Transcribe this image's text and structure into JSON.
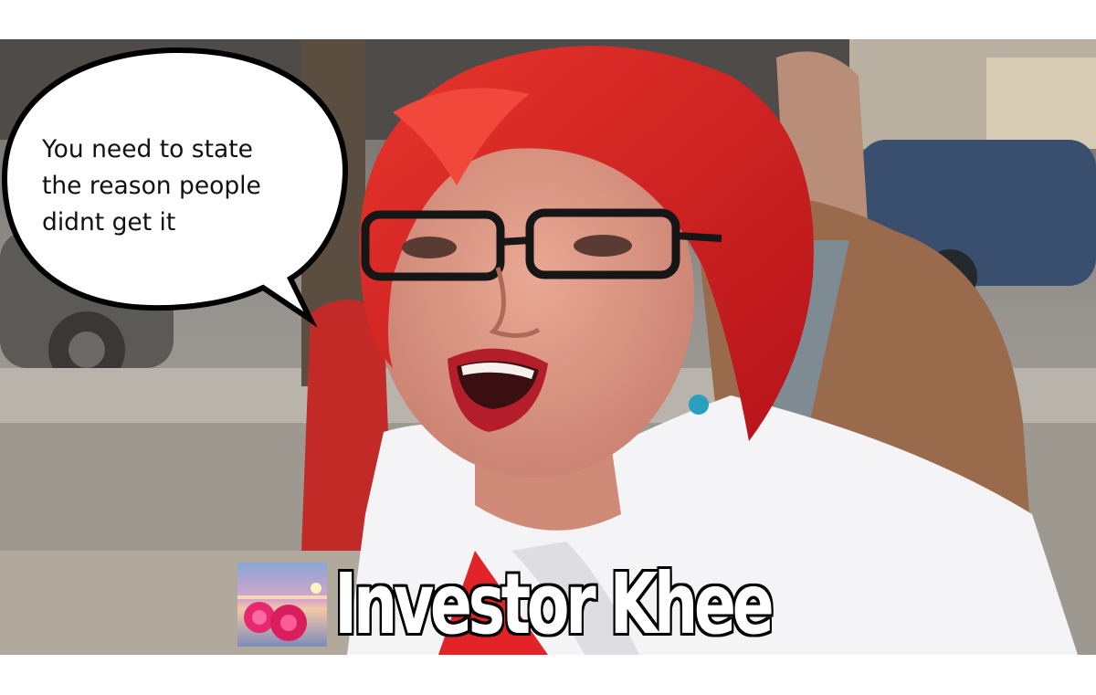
{
  "speech_bubble": {
    "lines": [
      "You need to state",
      "the reason people",
      "didnt get it"
    ]
  },
  "caption": {
    "text": "Investor Khee"
  },
  "colors": {
    "background": "#ffffff",
    "hair": "#d8201f",
    "jacket": "#f4f4f6",
    "caption_fill": "#ffffff",
    "caption_outline": "#000000"
  }
}
